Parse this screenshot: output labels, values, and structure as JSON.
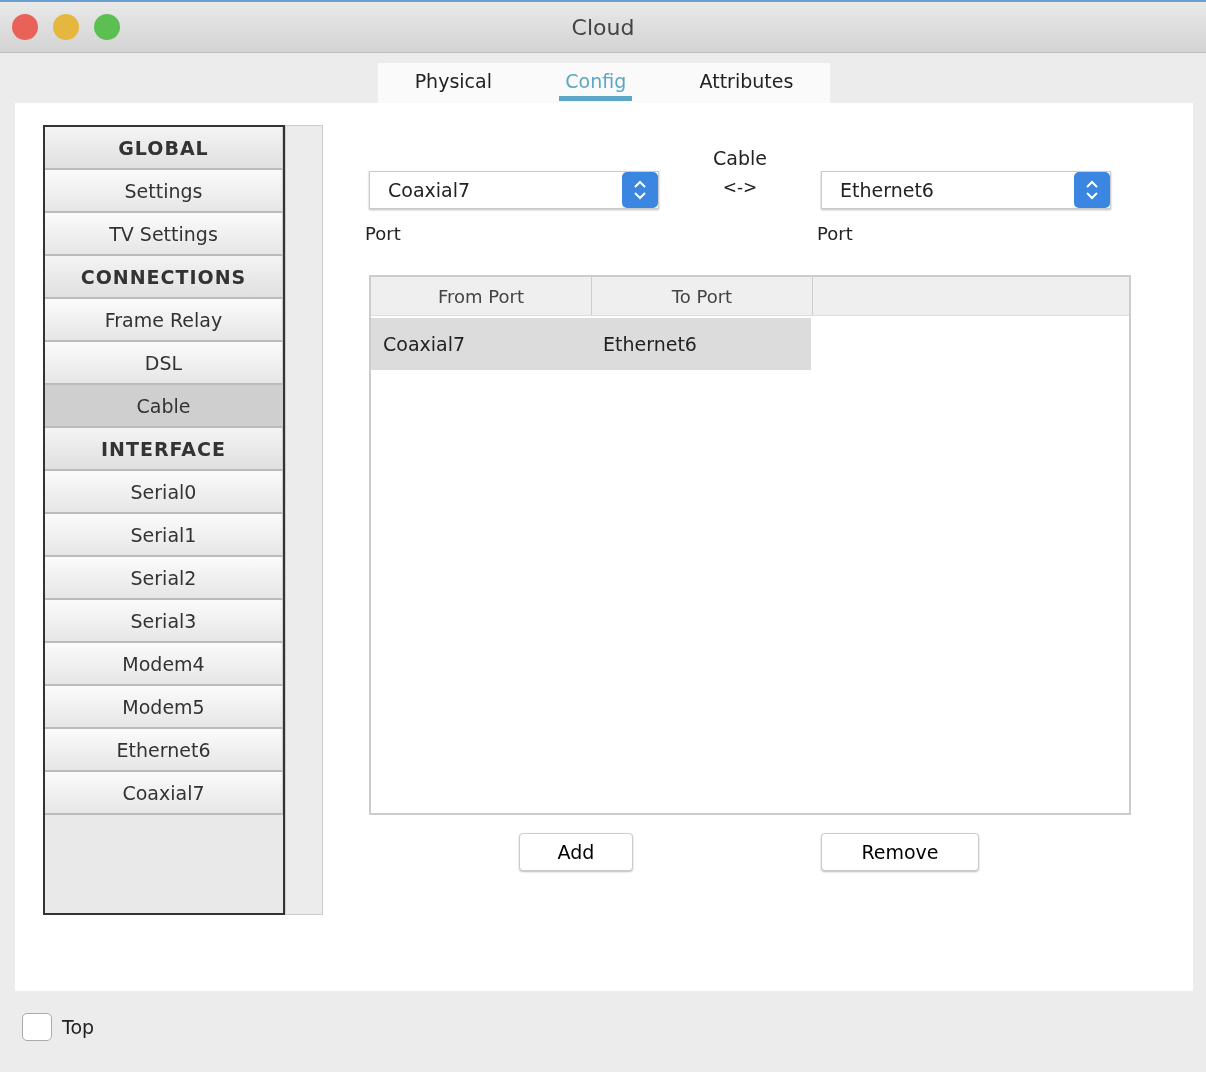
{
  "window": {
    "title": "Cloud"
  },
  "tabs": [
    {
      "label": "Physical",
      "selected": false
    },
    {
      "label": "Config",
      "selected": true
    },
    {
      "label": "Attributes",
      "selected": false
    }
  ],
  "sidebar": {
    "items": [
      {
        "kind": "header",
        "label": "GLOBAL",
        "selected": false
      },
      {
        "kind": "item",
        "label": "Settings",
        "selected": false
      },
      {
        "kind": "item",
        "label": "TV Settings",
        "selected": false
      },
      {
        "kind": "header",
        "label": "CONNECTIONS",
        "selected": false
      },
      {
        "kind": "item",
        "label": "Frame Relay",
        "selected": false
      },
      {
        "kind": "item",
        "label": "DSL",
        "selected": false
      },
      {
        "kind": "item",
        "label": "Cable",
        "selected": true
      },
      {
        "kind": "header",
        "label": "INTERFACE",
        "selected": false
      },
      {
        "kind": "item",
        "label": "Serial0",
        "selected": false
      },
      {
        "kind": "item",
        "label": "Serial1",
        "selected": false
      },
      {
        "kind": "item",
        "label": "Serial2",
        "selected": false
      },
      {
        "kind": "item",
        "label": "Serial3",
        "selected": false
      },
      {
        "kind": "item",
        "label": "Modem4",
        "selected": false
      },
      {
        "kind": "item",
        "label": "Modem5",
        "selected": false
      },
      {
        "kind": "item",
        "label": "Ethernet6",
        "selected": false
      },
      {
        "kind": "item",
        "label": "Coaxial7",
        "selected": false
      }
    ]
  },
  "cable": {
    "title": "Cable",
    "arrow": "<->",
    "from": {
      "value": "Coaxial7",
      "label": "Port"
    },
    "to": {
      "value": "Ethernet6",
      "label": "Port"
    }
  },
  "table": {
    "columns": [
      "From Port",
      "To Port"
    ],
    "rows": [
      {
        "cells": [
          "Coaxial7",
          "Ethernet6"
        ],
        "selected": true
      }
    ]
  },
  "buttons": [
    "Add",
    "Remove"
  ],
  "top": {
    "label": "Top",
    "checked": false
  }
}
